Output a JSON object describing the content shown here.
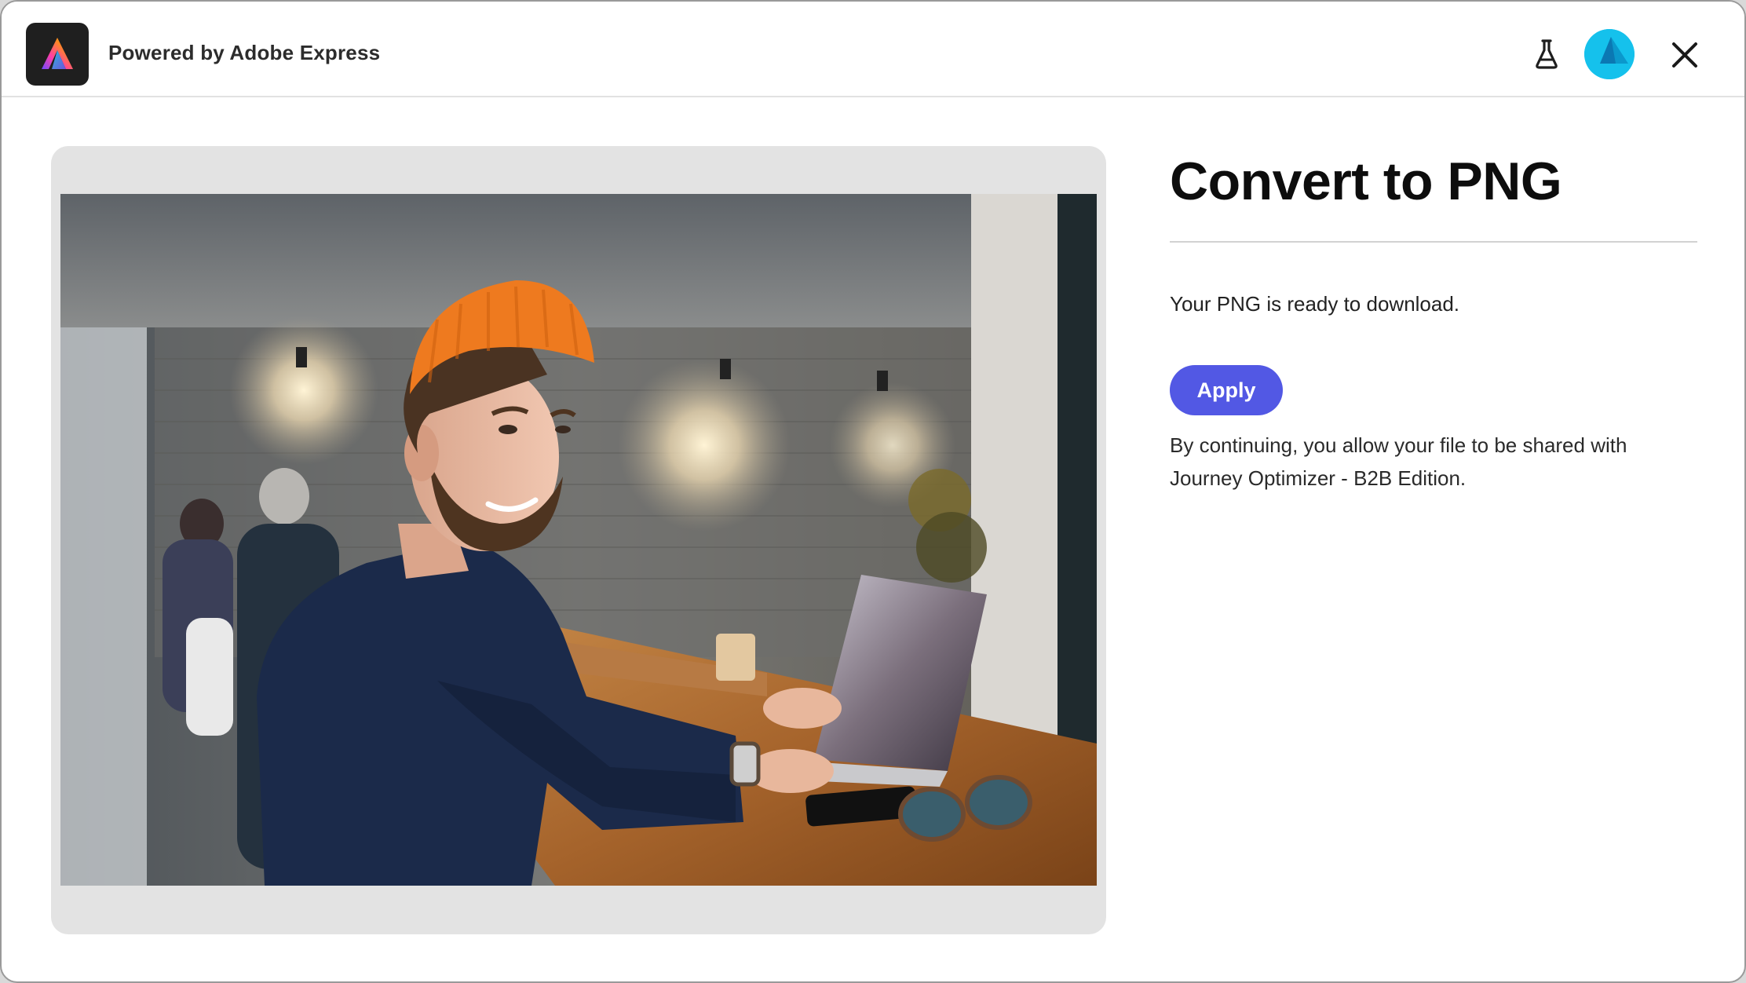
{
  "header": {
    "powered_by": "Powered by Adobe Express",
    "logo_icon": "adobe-express-logo",
    "flask_icon": "flask-icon",
    "avatar_icon": "avatar",
    "close_icon": "close-icon"
  },
  "preview": {
    "image_icon": "photo-preview"
  },
  "panel": {
    "title": "Convert to PNG",
    "ready_message": "Your PNG is ready to download.",
    "apply_label": "Apply",
    "consent_message": "By continuing, you allow your file to be shared with Journey Optimizer - B2B Edition."
  },
  "colors": {
    "accent": "#5258e4",
    "avatar": "#15c1ec",
    "logo_bg": "#1f1f1f"
  }
}
